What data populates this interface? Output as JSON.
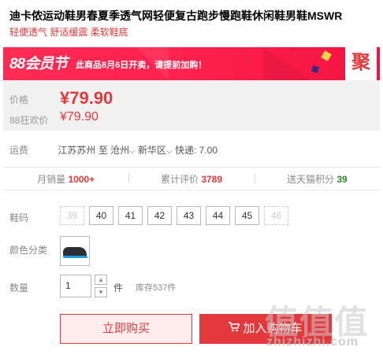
{
  "product": {
    "title": "迪卡侬运动鞋男春夏季透气网轻便复古跑步慢跑鞋休闲鞋男鞋MSWR",
    "subtitle": "轻便透气 舒适缓震 柔软鞋底"
  },
  "promo": {
    "logo": "88会员节",
    "notice": "此商品8月6日开卖，请提前加购！",
    "badge": "聚"
  },
  "price": {
    "label": "价格",
    "value": "¥79.90",
    "promo_label": "88狂欢价",
    "promo_value": "¥79.90"
  },
  "shipping": {
    "label": "运费",
    "from": "江苏苏州",
    "to_word": "至",
    "city": "沧州",
    "district": "新华区",
    "fee": "快递: 7.00"
  },
  "stats": {
    "monthly_sales_label": "月销量",
    "monthly_sales_value": "1000+",
    "reviews_label": "累计评价",
    "reviews_value": "3789",
    "points_label": "送天猫积分",
    "points_value": "39"
  },
  "options": {
    "size_label": "鞋码",
    "sizes": [
      "39",
      "40",
      "41",
      "42",
      "43",
      "44",
      "45",
      "46"
    ],
    "color_label": "颜色分类",
    "qty_label": "数量",
    "qty_value": "1",
    "qty_unit": "件",
    "stock": "库存537件"
  },
  "actions": {
    "buy_now": "立即购买",
    "add_to_cart": "加入购物车"
  },
  "watermark": {
    "text_zh": "值值值",
    "text_en": "zhizhizhi.com"
  },
  "colors": {
    "accent": "#e4393c",
    "promo_bg": "#ff2d55",
    "points_green": "#2a8a2a"
  }
}
